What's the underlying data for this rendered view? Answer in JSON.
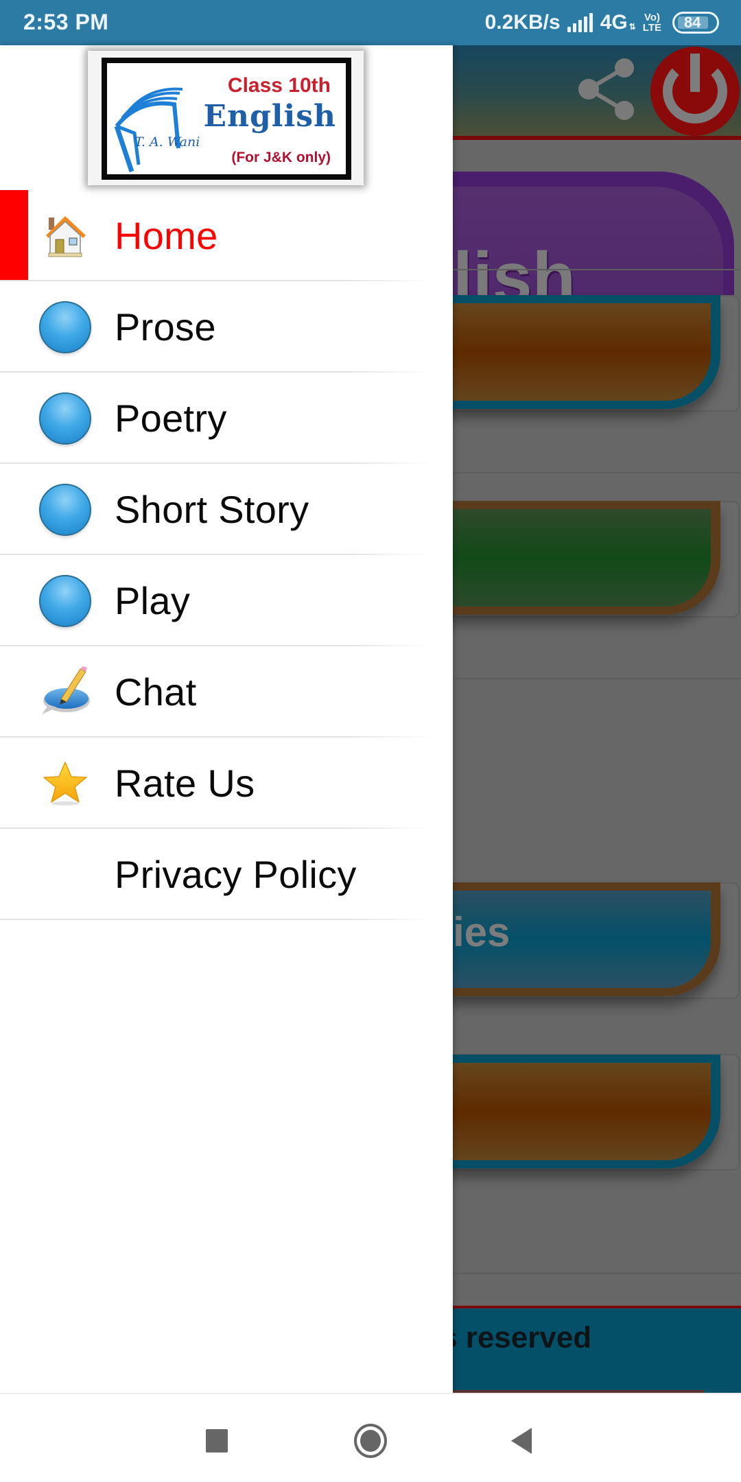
{
  "status_bar": {
    "time": "2:53 PM",
    "net_speed": "0.2KB/s",
    "network_type": "4G",
    "network_arrows": "⇅",
    "volte_top": "Vo)",
    "volte_bottom": "LTE",
    "battery_level": "84",
    "battery_fraction": 0.84,
    "color": "#2b7ba5"
  },
  "drawer": {
    "logo": {
      "class_text": "Class 10th",
      "subject_text": "English",
      "region_text": "(For J&K only)",
      "author_text": "T. A. Wani"
    },
    "menu": [
      {
        "label": "Home",
        "icon": "house-icon",
        "active": true
      },
      {
        "label": "Prose",
        "icon": "blue-ball-icon",
        "active": false
      },
      {
        "label": "Poetry",
        "icon": "blue-ball-icon",
        "active": false
      },
      {
        "label": "Short Story",
        "icon": "blue-ball-icon",
        "active": false
      },
      {
        "label": "Play",
        "icon": "blue-ball-icon",
        "active": false
      },
      {
        "label": "Chat",
        "icon": "chat-pencil-icon",
        "active": false
      },
      {
        "label": "Rate Us",
        "icon": "star-icon",
        "active": false
      },
      {
        "label": "Privacy Policy",
        "icon": "",
        "active": false
      }
    ],
    "active_color": "#ff0000"
  },
  "background_app": {
    "header_icons": [
      "share-icon",
      "power-icon"
    ],
    "title_fragment": "lish",
    "button_fragment": "ies",
    "footer_fragment": "s reserved"
  },
  "nav_bar": {
    "buttons": [
      "recents",
      "home",
      "back"
    ]
  }
}
